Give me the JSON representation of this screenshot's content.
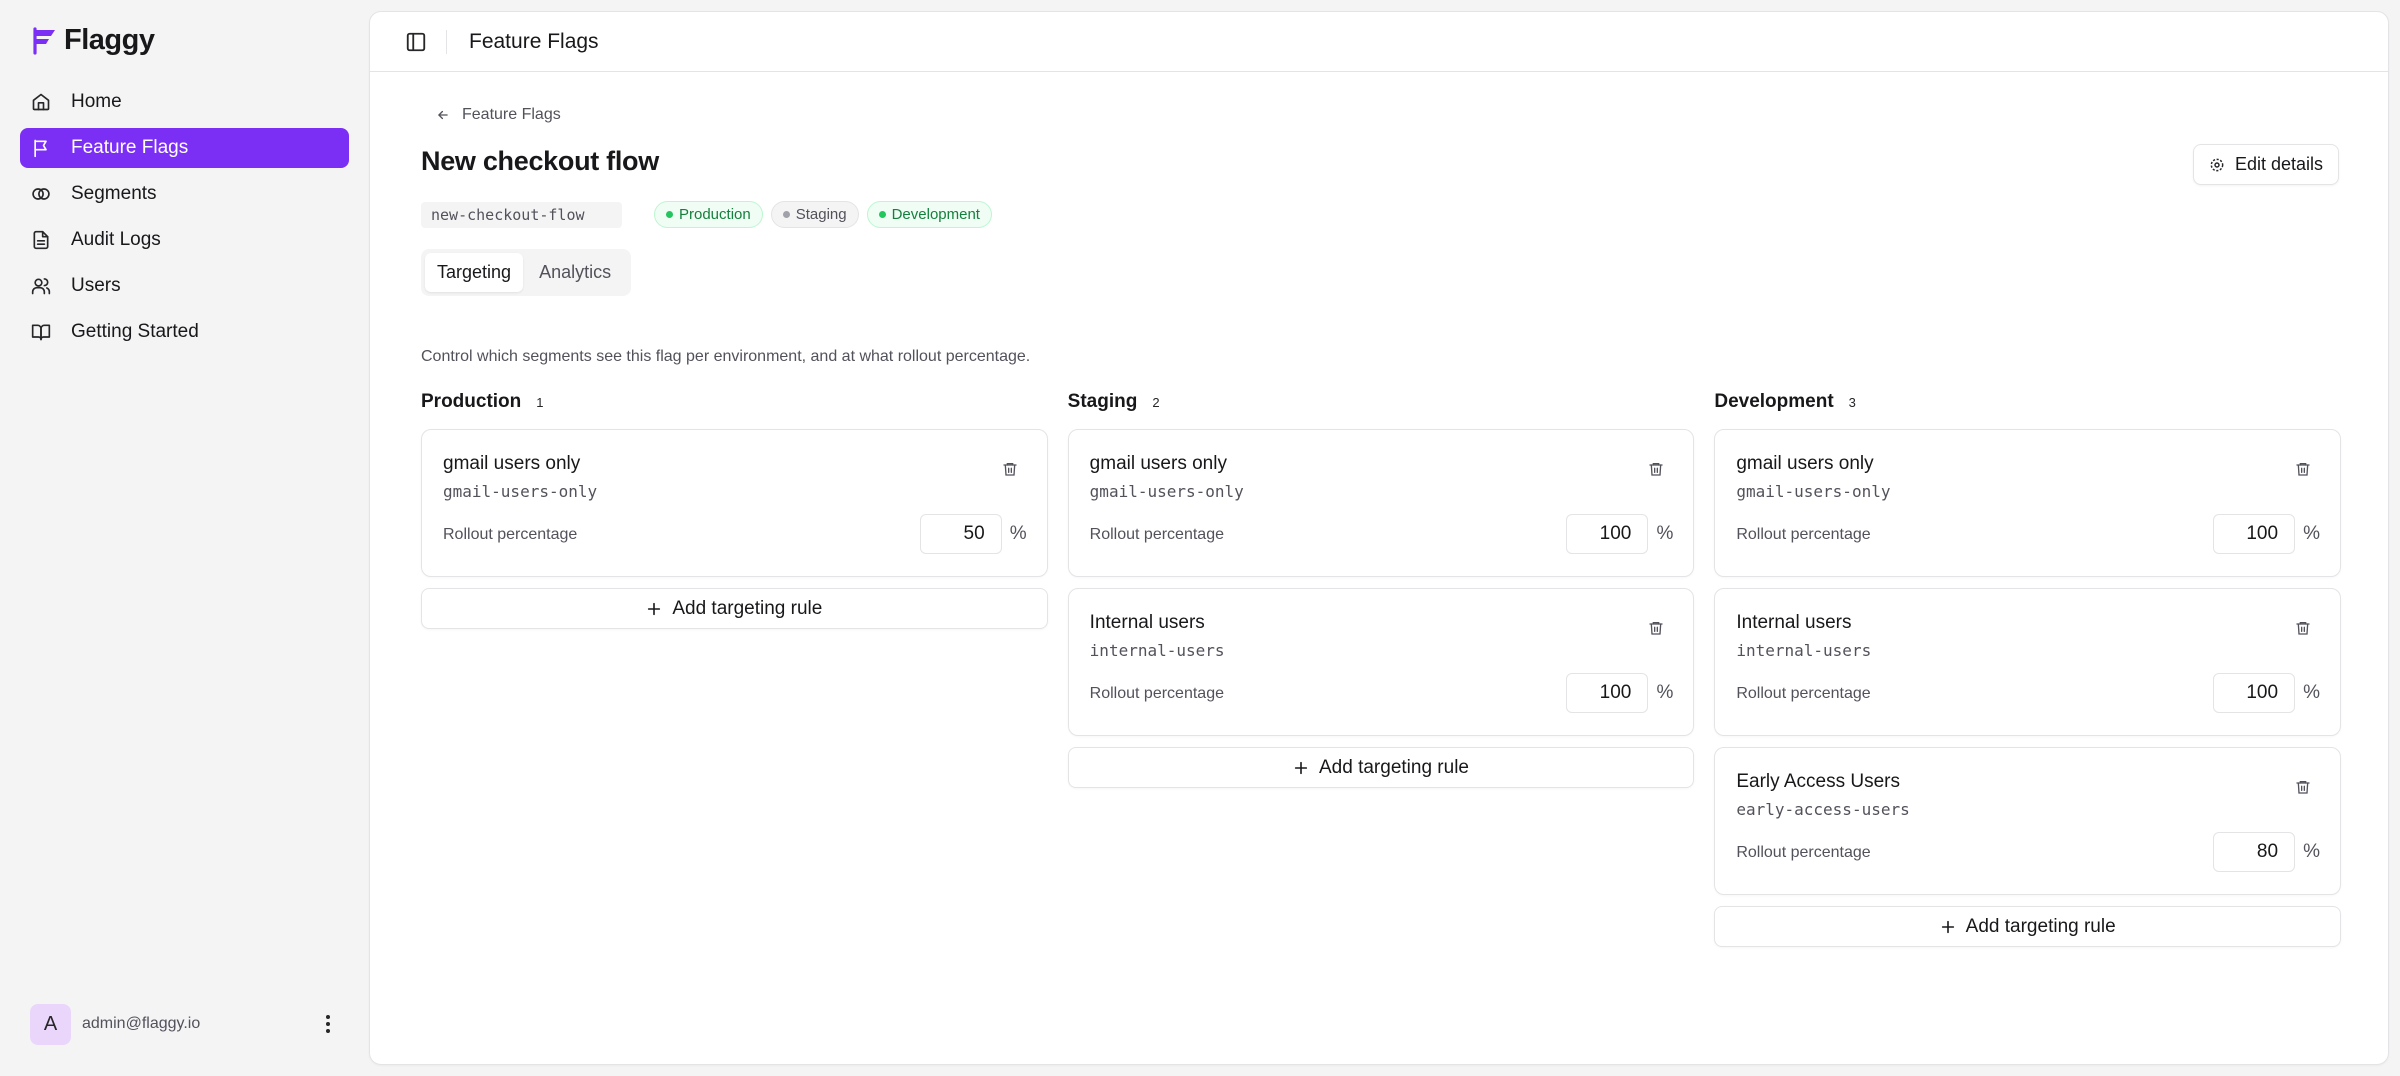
{
  "app": {
    "name": "Flaggy",
    "accent": "#7c2ff4"
  },
  "sidebar": {
    "items": [
      {
        "label": "Home",
        "icon": "home-icon"
      },
      {
        "label": "Feature Flags",
        "icon": "flag-icon",
        "active": true
      },
      {
        "label": "Segments",
        "icon": "segments-icon"
      },
      {
        "label": "Audit Logs",
        "icon": "file-text-icon"
      },
      {
        "label": "Users",
        "icon": "users-icon"
      },
      {
        "label": "Getting Started",
        "icon": "book-icon"
      }
    ],
    "user": {
      "initial": "A",
      "email": "admin@flaggy.io"
    }
  },
  "topbar": {
    "title": "Feature Flags"
  },
  "flag": {
    "back_label": "Feature Flags",
    "name": "New checkout flow",
    "key": "new-checkout-flow",
    "environments": [
      {
        "label": "Production",
        "enabled": true
      },
      {
        "label": "Staging",
        "enabled": false
      },
      {
        "label": "Development",
        "enabled": true
      }
    ],
    "edit_label": "Edit details"
  },
  "tabs": [
    {
      "label": "Targeting",
      "active": true
    },
    {
      "label": "Analytics",
      "active": false
    }
  ],
  "targeting": {
    "description": "Control which segments see this flag per environment, and at what rollout percentage.",
    "rollout_label": "Rollout percentage",
    "percent_sign": "%",
    "add_rule_label": "Add targeting rule",
    "columns": [
      {
        "env": "Production",
        "count": "1",
        "rules": [
          {
            "name": "gmail users only",
            "key": "gmail-users-only",
            "rollout": "50"
          }
        ]
      },
      {
        "env": "Staging",
        "count": "2",
        "rules": [
          {
            "name": "gmail users only",
            "key": "gmail-users-only",
            "rollout": "100"
          },
          {
            "name": "Internal users",
            "key": "internal-users",
            "rollout": "100"
          }
        ]
      },
      {
        "env": "Development",
        "count": "3",
        "rules": [
          {
            "name": "gmail users only",
            "key": "gmail-users-only",
            "rollout": "100"
          },
          {
            "name": "Internal users",
            "key": "internal-users",
            "rollout": "100"
          },
          {
            "name": "Early Access Users",
            "key": "early-access-users",
            "rollout": "80"
          }
        ]
      }
    ]
  }
}
